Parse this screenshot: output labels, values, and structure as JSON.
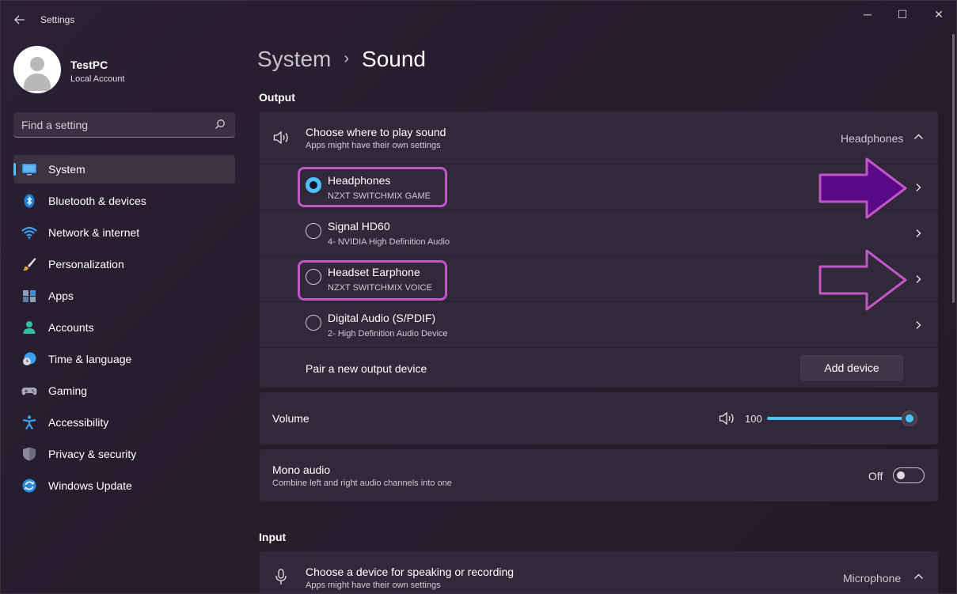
{
  "window": {
    "title": "Settings",
    "controls": {
      "minimize": "─",
      "maximize": "☐",
      "close": "✕"
    }
  },
  "profile": {
    "name": "TestPC",
    "account_type": "Local Account"
  },
  "search": {
    "placeholder": "Find a setting"
  },
  "sidebar": {
    "items": [
      {
        "label": "System",
        "icon": "monitor-icon",
        "active": true
      },
      {
        "label": "Bluetooth & devices",
        "icon": "bluetooth-icon"
      },
      {
        "label": "Network & internet",
        "icon": "wifi-icon"
      },
      {
        "label": "Personalization",
        "icon": "brush-icon"
      },
      {
        "label": "Apps",
        "icon": "apps-icon"
      },
      {
        "label": "Accounts",
        "icon": "person-icon"
      },
      {
        "label": "Time & language",
        "icon": "globe-clock-icon"
      },
      {
        "label": "Gaming",
        "icon": "gamepad-icon"
      },
      {
        "label": "Accessibility",
        "icon": "accessibility-icon"
      },
      {
        "label": "Privacy & security",
        "icon": "shield-icon"
      },
      {
        "label": "Windows Update",
        "icon": "update-icon"
      }
    ]
  },
  "breadcrumb": {
    "parent": "System",
    "separator": "›",
    "current": "Sound"
  },
  "output": {
    "section_title": "Output",
    "choose": {
      "title": "Choose where to play sound",
      "subtitle": "Apps might have their own settings",
      "selected_value": "Headphones"
    },
    "devices": [
      {
        "name": "Headphones",
        "detail": "NZXT SWITCHMIX GAME",
        "selected": true
      },
      {
        "name": "Signal HD60",
        "detail": "4- NVIDIA High Definition Audio",
        "selected": false
      },
      {
        "name": "Headset Earphone",
        "detail": "NZXT SWITCHMIX VOICE",
        "selected": false
      },
      {
        "name": "Digital Audio (S/PDIF)",
        "detail": "2- High Definition Audio Device",
        "selected": false
      }
    ],
    "pair": {
      "label": "Pair a new output device",
      "button": "Add device"
    },
    "volume": {
      "label": "Volume",
      "value": "100",
      "level": 1.0
    },
    "mono": {
      "title": "Mono audio",
      "subtitle": "Combine left and right audio channels into one",
      "state": "Off"
    }
  },
  "input": {
    "section_title": "Input",
    "choose": {
      "title": "Choose a device for speaking or recording",
      "subtitle": "Apps might have their own settings",
      "selected_value": "Microphone"
    }
  },
  "colors": {
    "accent": "#4cc2ff",
    "annotation_outline": "#c255c8",
    "annotation_fill": "#5a0a86"
  }
}
